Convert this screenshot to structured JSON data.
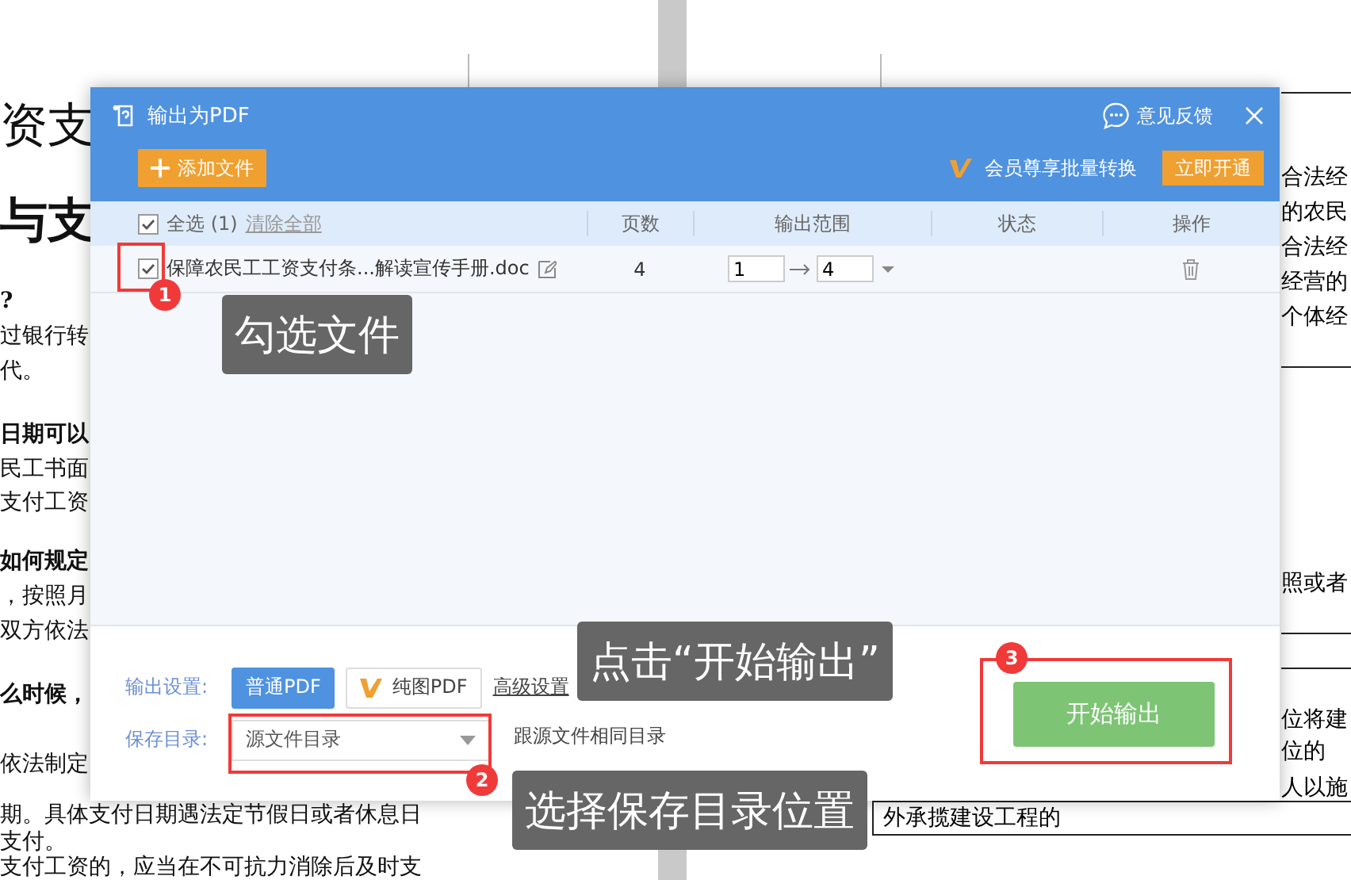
{
  "document": {
    "left_lines": [
      {
        "text": "资支",
        "kind": "title"
      },
      {
        "text": "与支",
        "kind": "title-bold"
      },
      {
        "text": "?",
        "kind": "bold"
      },
      {
        "text": "过银行转",
        "kind": "plain"
      },
      {
        "text": "代。",
        "kind": "plain"
      },
      {
        "text": "日期可以",
        "kind": "bold"
      },
      {
        "text": "民工书面",
        "kind": "plain"
      },
      {
        "text": "支付工资",
        "kind": "plain"
      },
      {
        "text": "如何规定",
        "kind": "bold"
      },
      {
        "text": "，按照月",
        "kind": "plain"
      },
      {
        "text": "双方依法",
        "kind": "plain"
      },
      {
        "text": "么时候，",
        "kind": "bold"
      },
      {
        "text": "依法制定",
        "kind": "plain"
      },
      {
        "text": "期。具体支付日期遇法定节假日或者休息日",
        "kind": "plain"
      },
      {
        "text": "支付。",
        "kind": "plain"
      },
      {
        "text": "支付工资的，应当在不可抗力消除后及时支",
        "kind": "plain"
      }
    ],
    "right_lines": [
      "合法经",
      "的农民",
      "合法经",
      "经营的",
      "个体经",
      "照或者",
      "位将建",
      "位的",
      "人以施"
    ],
    "boxed_line": "外承揽建设工程的"
  },
  "dialog": {
    "title": "输出为PDF",
    "feedback": "意见反馈",
    "add_button": "添加文件",
    "promo": "会员尊享批量转换",
    "promo_button": "立即开通",
    "table": {
      "select_all": {
        "label": "全选 (1)",
        "checked": true
      },
      "clear_link": "清除全部",
      "columns": [
        "页数",
        "输出范围",
        "状态",
        "操作"
      ],
      "rows": [
        {
          "checked": true,
          "name": "保障农民工工资支付条...解读宣传手册.doc",
          "pages": "4",
          "range_from": "1",
          "range_to": "4"
        }
      ]
    },
    "output_settings": {
      "label": "输出设置:",
      "modes": [
        {
          "label": "普通PDF",
          "selected": true,
          "vip": false
        },
        {
          "label": "纯图PDF",
          "selected": false,
          "vip": true
        }
      ],
      "advanced": "高级设置"
    },
    "save_dir": {
      "label": "保存目录:",
      "value": "源文件目录",
      "hint": "跟源文件相同目录"
    },
    "start_button": "开始输出"
  },
  "annotations": [
    {
      "number": "1",
      "text": "勾选文件"
    },
    {
      "number": "3",
      "text": "点击“开始输出”"
    },
    {
      "number": "2",
      "text": "选择保存目录位置"
    }
  ]
}
